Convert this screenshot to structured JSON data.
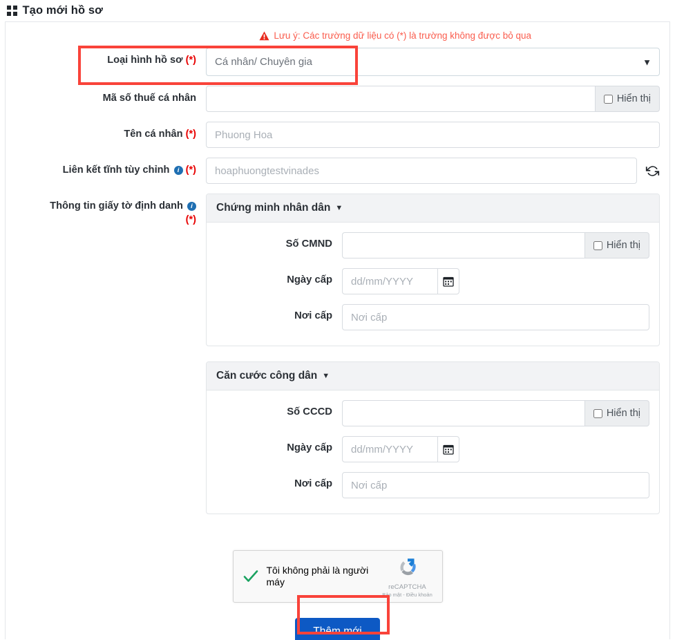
{
  "page": {
    "title": "Tạo mới hồ sơ",
    "title_icon": "grid-icon"
  },
  "notice": {
    "icon": "warning-triangle-icon",
    "text": "Lưu ý: Các trường dữ liệu có (*) là trường không được bỏ qua"
  },
  "form": {
    "profile_type": {
      "label": "Loại hình hồ sơ",
      "required_mark": "(*)",
      "value": "Cá nhân/ Chuyên gia",
      "options": [
        "Cá nhân/ Chuyên gia"
      ],
      "caret_icon": "chevron-down-icon"
    },
    "tax_code": {
      "label": "Mã số thuế cá nhân",
      "value": "",
      "placeholder": "",
      "addon_label": "Hiển thị",
      "addon_checked": false
    },
    "person_name": {
      "label": "Tên cá nhân",
      "required_mark": "(*)",
      "value": "",
      "placeholder": "Phuong Hoa"
    },
    "custom_link": {
      "label": "Liên kết tĩnh tùy chỉnh",
      "info_icon": "info-icon",
      "required_mark": "(*)",
      "value": "",
      "placeholder": "hoaphuongtestvinades",
      "refresh_icon": "refresh-icon"
    },
    "identity_docs": {
      "label": "Thông tin giấy tờ định danh",
      "info_icon": "info-icon",
      "required_mark": "(*)",
      "panels": [
        {
          "title": "Chứng minh nhân dân",
          "caret_icon": "caret-down-icon",
          "fields": {
            "number": {
              "label": "Số CMND",
              "value": "",
              "placeholder": "",
              "addon_label": "Hiển thị",
              "addon_checked": false
            },
            "issue_date": {
              "label": "Ngày cấp",
              "value": "",
              "placeholder": "dd/mm/YYYY",
              "calendar_icon": "calendar-icon"
            },
            "issue_place": {
              "label": "Nơi cấp",
              "value": "",
              "placeholder": "Nơi cấp"
            }
          }
        },
        {
          "title": "Căn cước công dân",
          "caret_icon": "caret-down-icon",
          "fields": {
            "number": {
              "label": "Số CCCD",
              "value": "",
              "placeholder": "",
              "addon_label": "Hiển thị",
              "addon_checked": false
            },
            "issue_date": {
              "label": "Ngày cấp",
              "value": "",
              "placeholder": "dd/mm/YYYY",
              "calendar_icon": "calendar-icon"
            },
            "issue_place": {
              "label": "Nơi cấp",
              "value": "",
              "placeholder": "Nơi cấp"
            }
          }
        }
      ]
    }
  },
  "captcha": {
    "label": "Tôi không phải là người máy",
    "checked": true,
    "check_icon": "green-check-icon",
    "logo_icon": "recaptcha-logo-icon",
    "brand": "reCAPTCHA",
    "terms": "Bảo mật - Điều khoản"
  },
  "submit": {
    "label": "Thêm mới"
  },
  "colors": {
    "accent_blue": "#0d59c4",
    "notice_red": "#fa5c4d",
    "required_red": "#e80000",
    "annotation_red": "#f9433a",
    "panel_header_bg": "#f2f3f5",
    "addon_bg": "#eceef0",
    "check_green": "#1aa260"
  },
  "annotations": [
    {
      "name": "profile-type-highlight"
    },
    {
      "name": "submit-button-highlight"
    }
  ]
}
